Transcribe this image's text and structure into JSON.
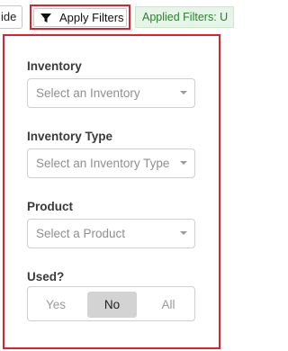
{
  "toolbar": {
    "hide_label": "ide",
    "apply_filters_label": "Apply Filters",
    "applied_filters_text": "Applied Filters: U"
  },
  "filters": {
    "inventory": {
      "label": "Inventory",
      "placeholder": "Select an Inventory"
    },
    "inventory_type": {
      "label": "Inventory Type",
      "placeholder": "Select an Inventory Type"
    },
    "product": {
      "label": "Product",
      "placeholder": "Select a Product"
    },
    "used": {
      "label": "Used?",
      "options": [
        "Yes",
        "No",
        "All"
      ],
      "selected": "No"
    }
  },
  "colors": {
    "highlight_outline": "#d9232e",
    "applied_badge_bg": "#e6f5e8",
    "applied_badge_text": "#2e7d32",
    "segment_active_bg": "#d3d3d3"
  },
  "icons": {
    "apply_filters_icon": "funnel-icon",
    "dropdown_caret": "chevron-down-icon"
  }
}
